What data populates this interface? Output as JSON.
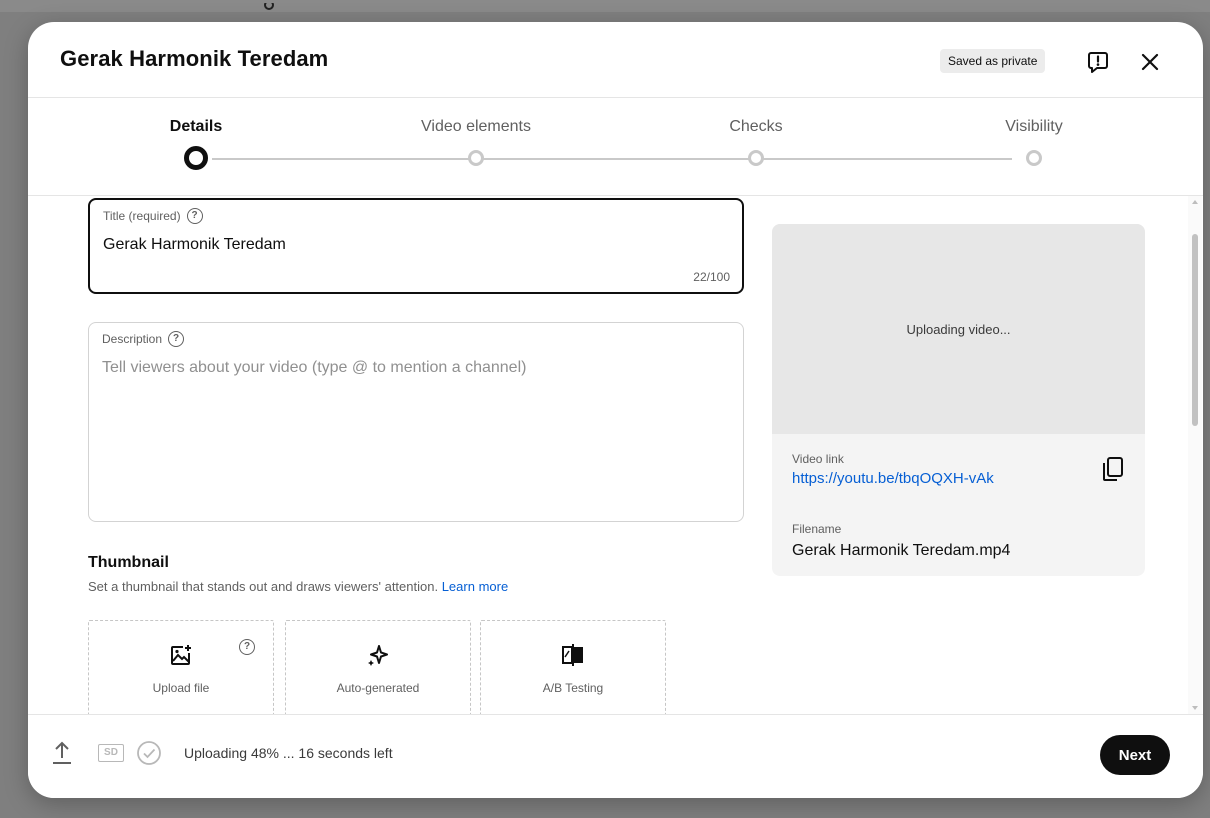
{
  "dialog": {
    "title": "Gerak Harmonik Teredam",
    "saved_badge": "Saved as private"
  },
  "stepper": {
    "steps": [
      {
        "label": "Details",
        "active": true
      },
      {
        "label": "Video elements",
        "active": false
      },
      {
        "label": "Checks",
        "active": false
      },
      {
        "label": "Visibility",
        "active": false
      }
    ]
  },
  "form": {
    "title_field": {
      "label": "Title (required)",
      "value": "Gerak Harmonik Teredam",
      "count": "22/100"
    },
    "description_field": {
      "label": "Description",
      "placeholder": "Tell viewers about your video (type @ to mention a channel)"
    }
  },
  "preview": {
    "status": "Uploading video...",
    "video_link_label": "Video link",
    "video_link": "https://youtu.be/tbqOQXH-vAk",
    "filename_label": "Filename",
    "filename": "Gerak Harmonik Teredam.mp4"
  },
  "thumbnail": {
    "heading": "Thumbnail",
    "description": "Set a thumbnail that stands out and draws viewers' attention.",
    "learn_more": "Learn more",
    "options": [
      {
        "label": "Upload file",
        "icon": "image-add-icon"
      },
      {
        "label": "Auto-generated",
        "icon": "sparkle-icon"
      },
      {
        "label": "A/B Testing",
        "icon": "ab-test-icon"
      }
    ]
  },
  "footer": {
    "sd_badge": "SD",
    "upload_status": "Uploading 48% ... 16 seconds left",
    "next_label": "Next"
  },
  "colors": {
    "accent": "#0f0f0f",
    "link": "#065fd4",
    "muted": "#606060"
  }
}
